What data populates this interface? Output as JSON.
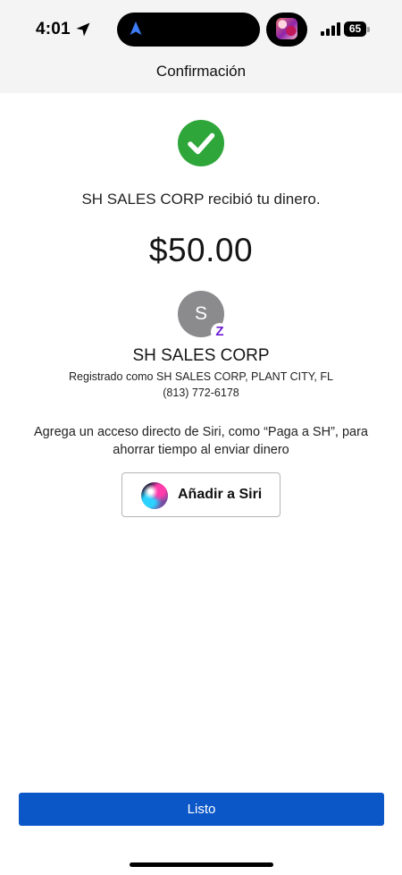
{
  "status_bar": {
    "time": "4:01",
    "battery_level": "65"
  },
  "nav": {
    "title": "Confirmación"
  },
  "confirmation": {
    "received_message": "SH SALES CORP recibió tu dinero.",
    "amount": "$50.00"
  },
  "recipient": {
    "initial": "S",
    "badge": "Z",
    "name": "SH SALES CORP",
    "registered_as": "Registrado como SH SALES CORP, PLANT CITY, FL",
    "phone": "(813) 772-6178"
  },
  "siri": {
    "prompt": "Agrega un acceso directo de Siri, como “Paga a SH”, para ahorrar tiempo al enviar dinero",
    "button_label": "Añadir a Siri"
  },
  "actions": {
    "done_label": "Listo"
  },
  "colors": {
    "success_green": "#2ea63a",
    "primary_blue": "#0b57c8",
    "zelle_purple": "#6d1ed4",
    "avatar_gray": "#8b8b8d"
  },
  "icons": {
    "status": [
      "location-arrow-icon",
      "navigation-icon",
      "signal-icon",
      "battery-icon"
    ],
    "content": [
      "checkmark-icon",
      "zelle-icon",
      "siri-icon"
    ]
  }
}
